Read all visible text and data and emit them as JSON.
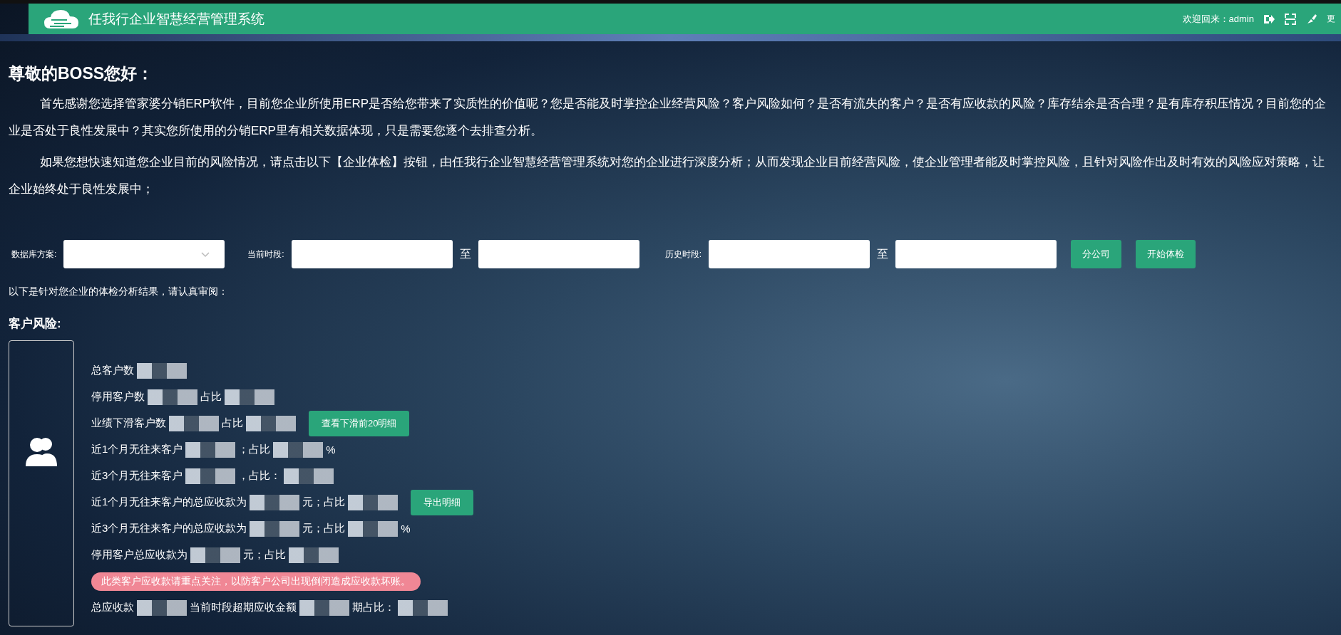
{
  "header": {
    "title": "任我行企业智慧经营管理系统",
    "welcome": "欢迎回来：admin",
    "cut_label": "更"
  },
  "greeting": {
    "title": "尊敬的BOSS您好：",
    "paragraphs": [
      "首先感谢您选择管家婆分销ERP软件，目前您企业所使用ERP是否给您带来了实质性的价值呢？您是否能及时掌控企业经营风险？客户风险如何？是否有流失的客户？是否有应收款的风险？库存结余是否合理？是有库存积压情况？目前您的企业是否处于良性发展中？其实您所使用的分销ERP里有相关数据体现，只是需要您逐个去排查分析。",
      "如果您想快速知道您企业目前的风险情况，请点击以下【企业体检】按钮，由任我行企业智慧经营管理系统对您的企业进行深度分析；从而发现企业目前经营风险，使企业管理者能及时掌控风险，且针对风险作出及时有效的风险应对策略，让企业始终处于良性发展中；"
    ]
  },
  "filters": {
    "database_label": "数据库方案:",
    "current_label": "当前时段:",
    "current_to": "至",
    "history_label": "历史时段:",
    "history_to": "至",
    "buttons": [
      "分公司",
      "开始体检"
    ]
  },
  "result_intro": "以下是针对您企业的体检分析结果，请认真审阅：",
  "customer_risk": {
    "title": "客户风险:",
    "rows": [
      {
        "kind": "line",
        "parts": [
          {
            "kind": "text",
            "text": "总客户数"
          },
          {
            "kind": "blur"
          }
        ]
      },
      {
        "kind": "line",
        "parts": [
          {
            "kind": "text",
            "text": "停用客户数"
          },
          {
            "kind": "blur"
          },
          {
            "kind": "text",
            "text": "占比"
          },
          {
            "kind": "blur"
          }
        ]
      },
      {
        "kind": "line",
        "parts": [
          {
            "kind": "text",
            "text": "业绩下滑客户数"
          },
          {
            "kind": "blur"
          },
          {
            "kind": "text",
            "text": "占比"
          },
          {
            "kind": "blur"
          },
          {
            "kind": "button",
            "text": "查看下滑前20明细"
          }
        ]
      },
      {
        "kind": "line",
        "parts": [
          {
            "kind": "text",
            "text": "近1个月无往来客户"
          },
          {
            "kind": "blur"
          },
          {
            "kind": "text",
            "text": "；占比"
          },
          {
            "kind": "blur"
          },
          {
            "kind": "text",
            "text": "%"
          }
        ]
      },
      {
        "kind": "line",
        "parts": [
          {
            "kind": "text",
            "text": "近3个月无往来客户"
          },
          {
            "kind": "blur"
          },
          {
            "kind": "text",
            "text": "，占比："
          },
          {
            "kind": "blur"
          }
        ]
      },
      {
        "kind": "line",
        "parts": [
          {
            "kind": "text",
            "text": "近1个月无往来客户的总应收款为"
          },
          {
            "kind": "blur"
          },
          {
            "kind": "text",
            "text": "元；占比"
          },
          {
            "kind": "blur"
          },
          {
            "kind": "button",
            "text": "导出明细"
          }
        ]
      },
      {
        "kind": "line",
        "parts": [
          {
            "kind": "text",
            "text": "近3个月无往来客户的总应收款为"
          },
          {
            "kind": "blur"
          },
          {
            "kind": "text",
            "text": "元；占比"
          },
          {
            "kind": "blur"
          },
          {
            "kind": "text",
            "text": "%"
          }
        ]
      },
      {
        "kind": "line",
        "parts": [
          {
            "kind": "text",
            "text": "停用客户总应收款为"
          },
          {
            "kind": "blur"
          },
          {
            "kind": "text",
            "text": "元；占比"
          },
          {
            "kind": "blur"
          }
        ]
      },
      {
        "kind": "alert",
        "text": "此类客户应收款请重点关注，以防客户公司出现倒闭造成应收款坏账。"
      },
      {
        "kind": "line",
        "parts": [
          {
            "kind": "text",
            "text": "总应收款"
          },
          {
            "kind": "blur"
          },
          {
            "kind": "text",
            "text": "当前时段超期应收金额"
          },
          {
            "kind": "blur"
          },
          {
            "kind": "text",
            "text": "期占比："
          },
          {
            "kind": "blur"
          }
        ]
      }
    ]
  }
}
